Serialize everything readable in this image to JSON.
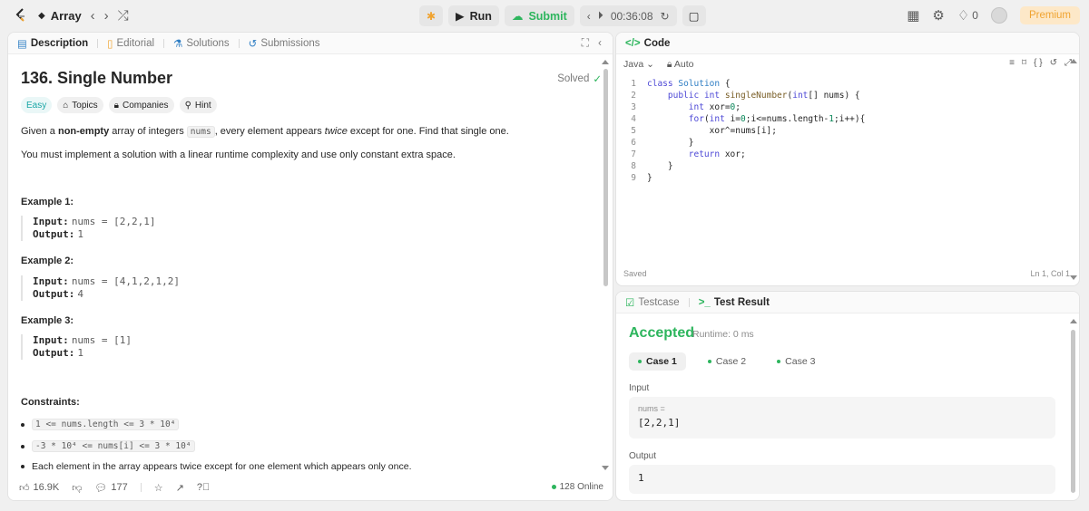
{
  "topbar": {
    "problem_list_label": "Array",
    "run_label": "Run",
    "submit_label": "Submit",
    "timer": "00:36:08",
    "streak_count": "0",
    "premium_label": "Premium"
  },
  "left_tabs": [
    "Description",
    "Editorial",
    "Solutions",
    "Submissions"
  ],
  "problem": {
    "title": "136. Single Number",
    "status": "Solved",
    "tags": [
      "Easy",
      "Topics",
      "Companies",
      "Hint"
    ],
    "desc_p1_a": "Given a ",
    "desc_p1_b": "non-empty",
    "desc_p1_c": " array of integers ",
    "desc_p1_code": "nums",
    "desc_p1_d": ", every element appears ",
    "desc_p1_e": "twice",
    "desc_p1_f": " except for one. Find that single one.",
    "desc_p2": "You must implement a solution with a linear runtime complexity and use only constant extra space.",
    "examples": [
      {
        "title": "Example 1:",
        "input": "nums = [2,2,1]",
        "output": "1"
      },
      {
        "title": "Example 2:",
        "input": "nums = [4,1,2,1,2]",
        "output": "4"
      },
      {
        "title": "Example 3:",
        "input": "nums = [1]",
        "output": "1"
      }
    ],
    "input_label": "Input:",
    "output_label": "Output:",
    "constraints_title": "Constraints:",
    "constraints": [
      "1 <= nums.length <= 3 * 10⁴",
      "-3 * 10⁴ <= nums[i] <= 3 * 10⁴",
      "Each element in the array appears twice except for one element which appears only once."
    ]
  },
  "footer": {
    "likes": "16.9K",
    "comments": "177",
    "online": "128 Online"
  },
  "code": {
    "tab_label": "Code",
    "language": "Java",
    "format": "Auto",
    "saved": "Saved",
    "cursor": "Ln 1, Col 1",
    "lines": [
      "class Solution {",
      "    public int singleNumber(int[] nums) {",
      "        int xor=0;",
      "        for(int i=0;i<=nums.length-1;i++){",
      "            xor^=nums[i];",
      "        }",
      "        return xor;",
      "    }",
      "}"
    ]
  },
  "result": {
    "tab_testcase": "Testcase",
    "tab_result": "Test Result",
    "status": "Accepted",
    "runtime": "Runtime: 0 ms",
    "cases": [
      "Case 1",
      "Case 2",
      "Case 3"
    ],
    "input_label": "Input",
    "var_label": "nums =",
    "input_value": "[2,2,1]",
    "output_label": "Output",
    "output_value": "1"
  }
}
